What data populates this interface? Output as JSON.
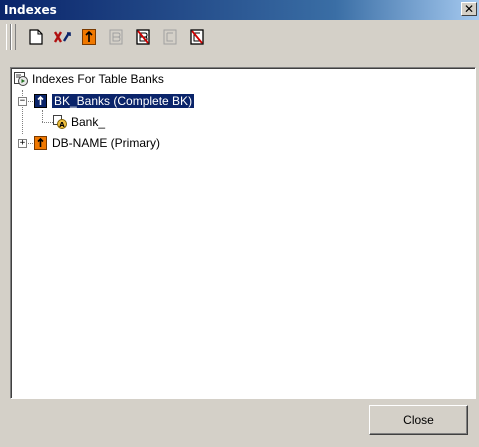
{
  "window": {
    "title": "Indexes"
  },
  "toolbar": {
    "buttons": [
      {
        "name": "new-index-icon",
        "enabled": true
      },
      {
        "name": "delete-index-icon",
        "enabled": true
      },
      {
        "name": "primary-index-icon",
        "enabled": true
      },
      {
        "name": "field-icon",
        "enabled": false
      },
      {
        "name": "remove-field-icon",
        "enabled": true
      },
      {
        "name": "field-icon-2",
        "enabled": false
      },
      {
        "name": "remove-field-icon-2",
        "enabled": true
      }
    ]
  },
  "tree": {
    "root": "Indexes For Table Banks",
    "items": [
      {
        "label": "BK_Banks (Complete BK)",
        "selected": true,
        "expanded": true,
        "children": [
          "Bank_"
        ]
      },
      {
        "label": "DB-NAME (Primary)",
        "selected": false,
        "expanded": false
      }
    ]
  },
  "footer": {
    "close_label": "Close"
  },
  "colors": {
    "title_start": "#0a246a",
    "selection": "#0a246a",
    "key_orange": "#f07800",
    "key_blue": "#0a246a"
  }
}
